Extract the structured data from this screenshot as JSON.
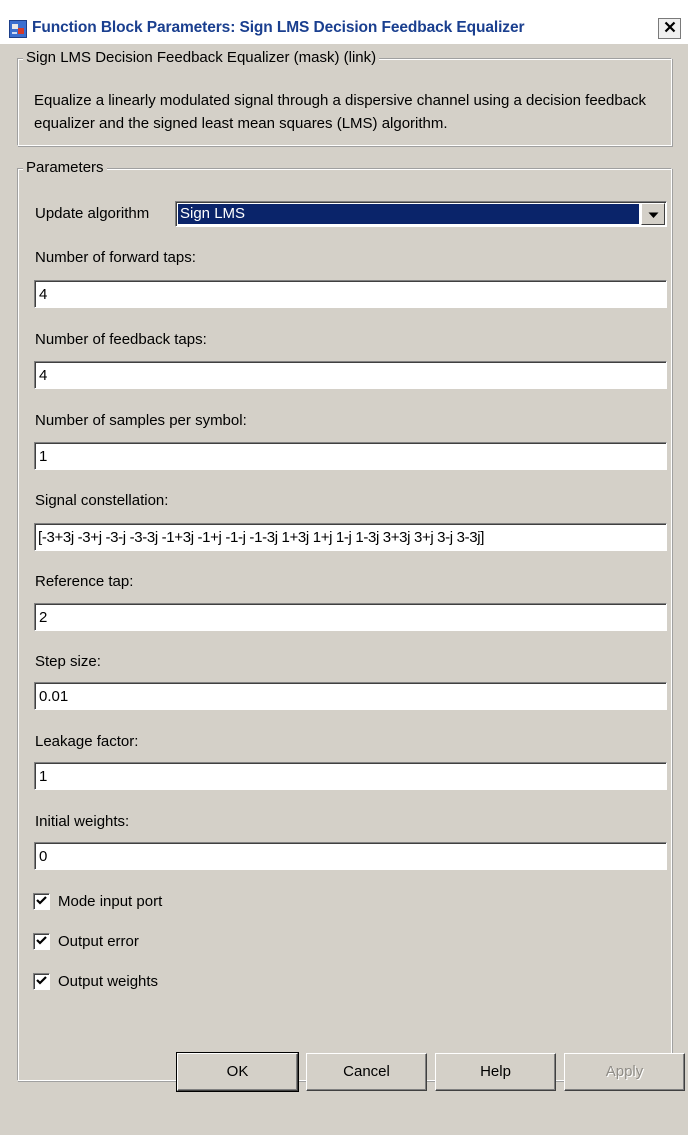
{
  "window": {
    "title": "Function Block Parameters: Sign LMS Decision Feedback Equalizer",
    "close_glyph": "✕"
  },
  "description_group": {
    "legend": "Sign LMS Decision Feedback Equalizer (mask) (link)",
    "text": "Equalize a linearly modulated signal through a dispersive channel using a decision feedback equalizer and the signed least mean squares (LMS) algorithm."
  },
  "parameters": {
    "legend": "Parameters",
    "update_algorithm": {
      "label": "Update algorithm",
      "value": "Sign LMS"
    },
    "forward_taps": {
      "label": "Number of forward taps:",
      "value": "4"
    },
    "feedback_taps": {
      "label": "Number of feedback taps:",
      "value": "4"
    },
    "samples_per_symbol": {
      "label": "Number of samples per symbol:",
      "value": "1"
    },
    "signal_constellation": {
      "label": "Signal constellation:",
      "value": "[-3+3j -3+j -3-j -3-3j -1+3j -1+j -1-j -1-3j 1+3j 1+j 1-j 1-3j 3+3j 3+j 3-j 3-3j]"
    },
    "reference_tap": {
      "label": "Reference tap:",
      "value": "2"
    },
    "step_size": {
      "label": "Step size:",
      "value": "0.01"
    },
    "leakage_factor": {
      "label": "Leakage factor:",
      "value": "1"
    },
    "initial_weights": {
      "label": "Initial weights:",
      "value": "0"
    },
    "checkboxes": [
      {
        "label": "Mode input port",
        "checked": true
      },
      {
        "label": "Output error",
        "checked": true
      },
      {
        "label": "Output weights",
        "checked": true
      }
    ]
  },
  "buttons": {
    "ok": "OK",
    "cancel": "Cancel",
    "help": "Help",
    "apply": "Apply"
  },
  "icons": {
    "app": "simulink-block-icon",
    "close": "close-icon",
    "dropdown": "chevron-down-icon",
    "check": "checkmark-icon"
  },
  "colors": {
    "dialog_bg": "#d4d0c8",
    "selection_bg": "#0a246a",
    "title_text": "#1a3f8f"
  }
}
